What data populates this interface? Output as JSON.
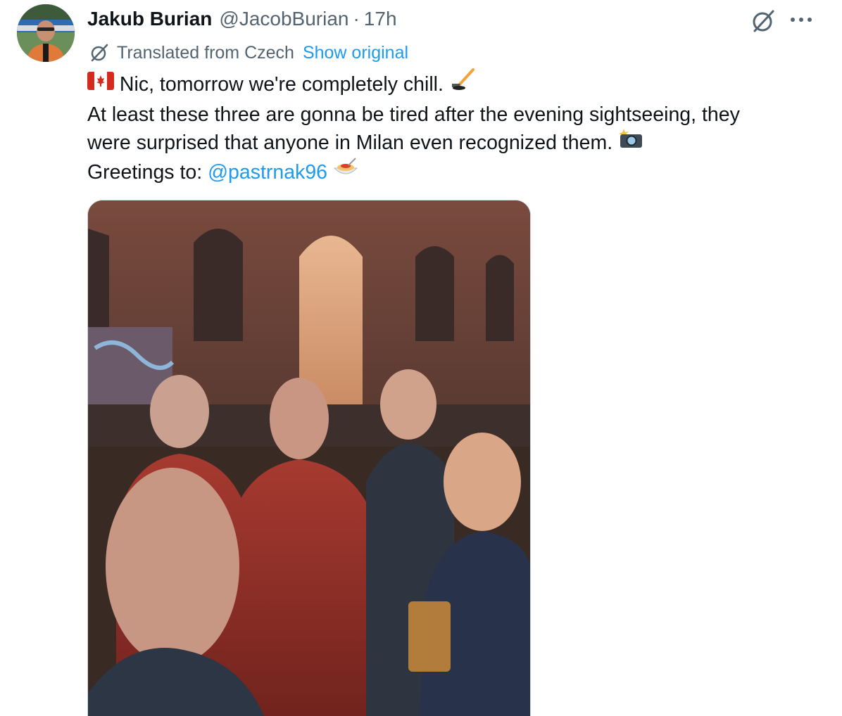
{
  "author": {
    "display_name": "Jakub Burian",
    "handle": "@JacobBurian",
    "separator": "·",
    "timestamp": "17h",
    "avatar_icon": "profile-photo"
  },
  "actions": {
    "grok_icon": "grok-icon",
    "more_icon": "more-horizontal-icon"
  },
  "translation": {
    "label": "Translated from Czech",
    "show_original": "Show original",
    "icon": "grok-icon"
  },
  "body": {
    "line1": "Nic, tomorrow we're completely chill.",
    "line1_emoji_start": "canada-flag",
    "line1_emoji_end": "ice-hockey",
    "line2": "At least these three are gonna be tired after the evening sightseeing, they",
    "line3": "were surprised that anyone in Milan even recognized them.",
    "line3_emoji": "camera-with-flash",
    "line4_prefix": "Greetings to:",
    "mention": "@pastrnak96",
    "line4_emoji": "spaghetti"
  },
  "media": {
    "type": "photo",
    "icon": "selfie-photo"
  },
  "colors": {
    "link": "#1d9bf0",
    "secondary": "#536471",
    "primary_text": "#0f1419",
    "border": "#cfd9de"
  }
}
